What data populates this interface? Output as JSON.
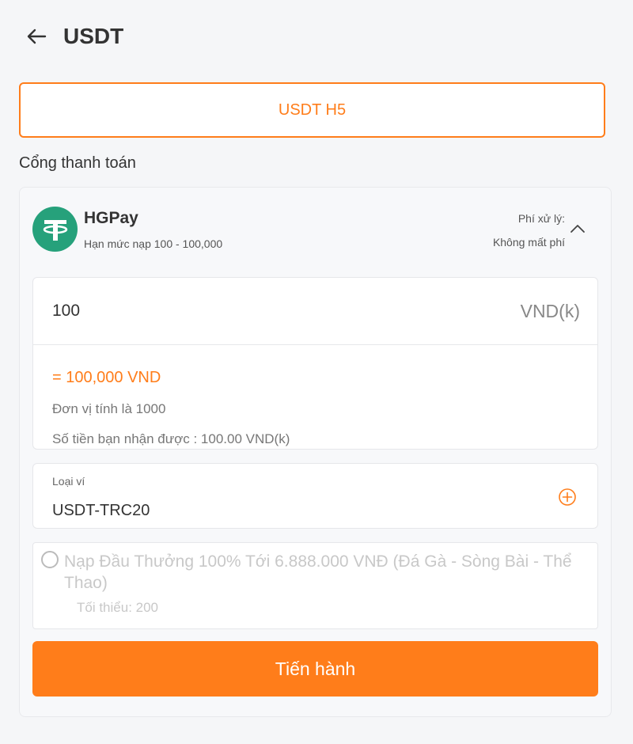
{
  "header": {
    "title": "USDT",
    "back_icon": "arrow-left-icon"
  },
  "method": {
    "label": "USDT H5",
    "accent": "#ff7d1a"
  },
  "section": {
    "label": "Cổng thanh toán"
  },
  "gateway": {
    "name": "HGPay",
    "limit": "Hạn mức nạp 100 - 100,000",
    "fee_label": "Phí xử lý:",
    "fee_value": "Không mất phí",
    "logo_icon": "tether-logo-icon",
    "logo_color": "#26a17b"
  },
  "amount": {
    "value": "100",
    "unit": "VND(k)",
    "converted": "= 100,000 VND",
    "unit_note": "Đơn vị tính là 1000",
    "receive_note": "Số tiền bạn nhận được : 100.00 VND(k)"
  },
  "wallet": {
    "label": "Loại ví",
    "value": "USDT-TRC20"
  },
  "promo": {
    "title": "Nạp Đầu Thưởng 100% Tới 6.888.000 VNĐ (Đá Gà - Sòng Bài - Thể Thao)",
    "minimum": "Tối thiểu: 200"
  },
  "submit": {
    "label": "Tiến hành"
  }
}
